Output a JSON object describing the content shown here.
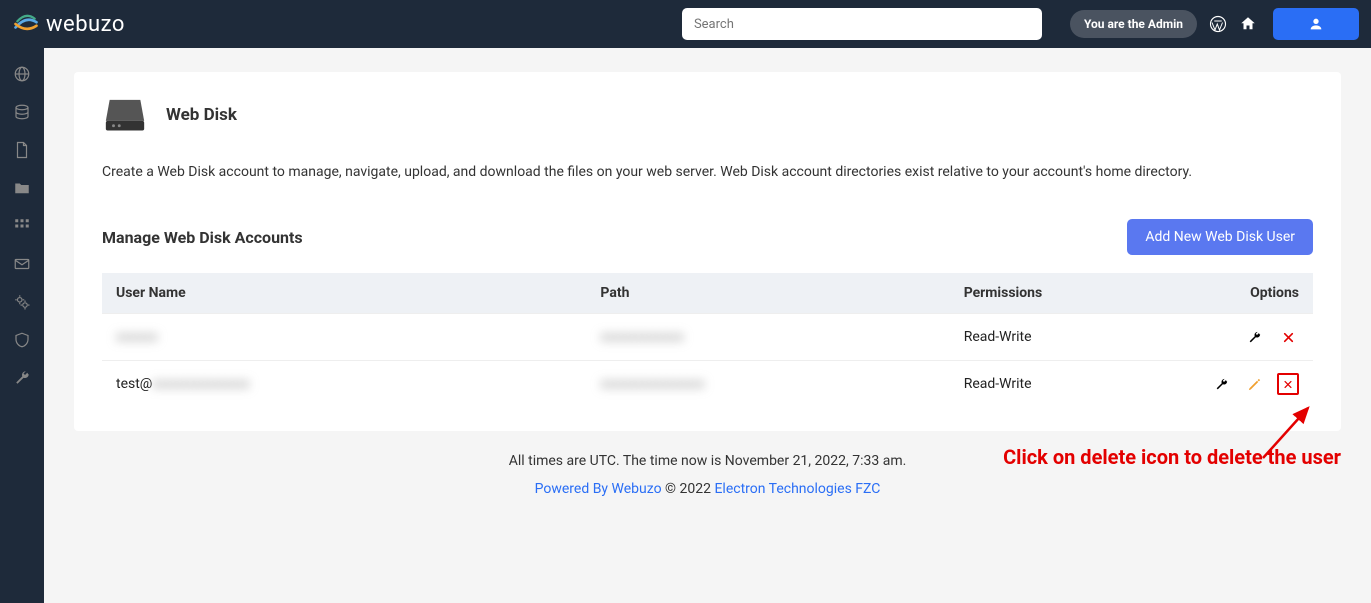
{
  "brand": "webuzo",
  "search": {
    "placeholder": "Search"
  },
  "admin_badge": "You are the Admin",
  "page": {
    "title": "Web Disk",
    "description": "Create a Web Disk account to manage, navigate, upload, and download the files on your web server. Web Disk account directories exist relative to your account's home directory.",
    "section_title": "Manage Web Disk Accounts",
    "add_button": "Add New Web Disk User"
  },
  "table": {
    "headers": {
      "user": "User Name",
      "path": "Path",
      "perm": "Permissions",
      "opts": "Options"
    },
    "rows": [
      {
        "user": "",
        "path": "",
        "perm": "Read-Write",
        "blurred": true
      },
      {
        "user": "test@",
        "path": "",
        "perm": "Read-Write",
        "blurred": false
      }
    ]
  },
  "footer": {
    "time_text": "All times are UTC. The time now is November 21, 2022, 7:33 am.",
    "powered_label": "Powered By Webuzo",
    "copyright": " © 2022 ",
    "company": "Electron Technologies FZC"
  },
  "annotation": "Click on delete icon to delete the user"
}
